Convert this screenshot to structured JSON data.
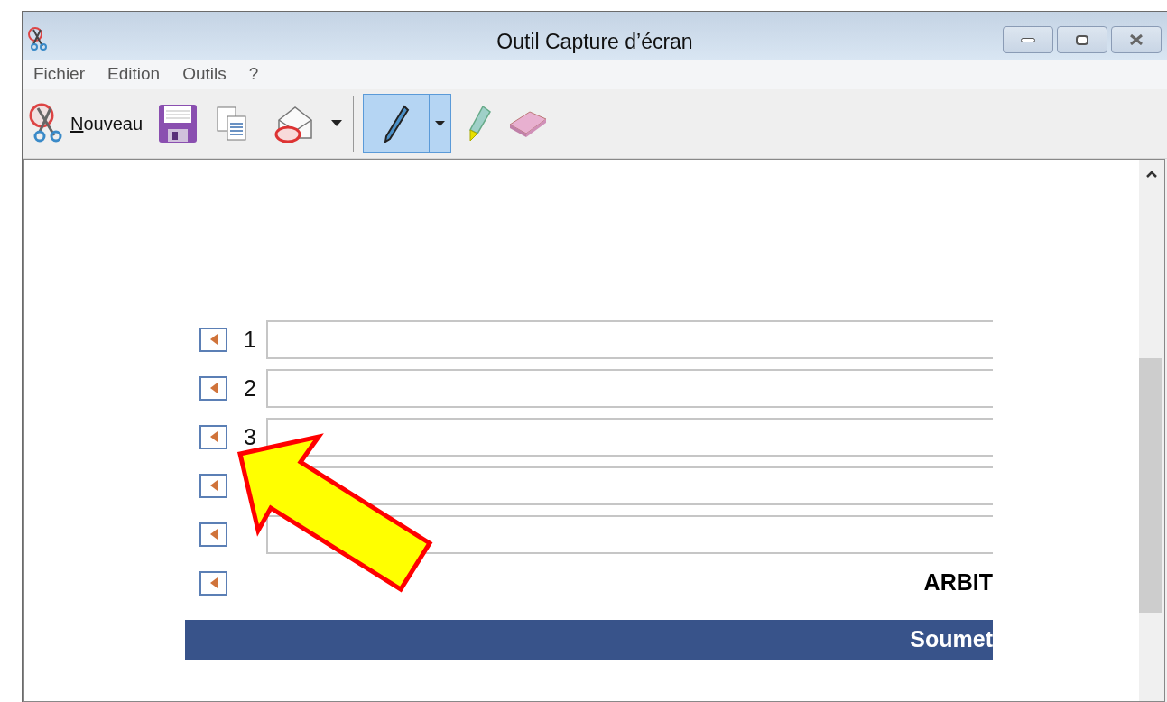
{
  "window": {
    "title": "Outil Capture d’écran"
  },
  "menu": [
    "Fichier",
    "Edition",
    "Outils",
    "?"
  ],
  "toolbar": {
    "new_label": "Nouveau",
    "tools": [
      {
        "kind": "pen",
        "selected": true
      },
      {
        "kind": "highlighter",
        "selected": false
      },
      {
        "kind": "eraser",
        "selected": false
      }
    ]
  },
  "rows": [
    {
      "kind": "field",
      "number": "1"
    },
    {
      "kind": "field",
      "number": "2"
    },
    {
      "kind": "field",
      "number": "3"
    },
    {
      "kind": "field"
    },
    {
      "kind": "field"
    },
    {
      "kind": "label",
      "text": "ARBIT"
    }
  ],
  "submit_bar": "Soumet"
}
